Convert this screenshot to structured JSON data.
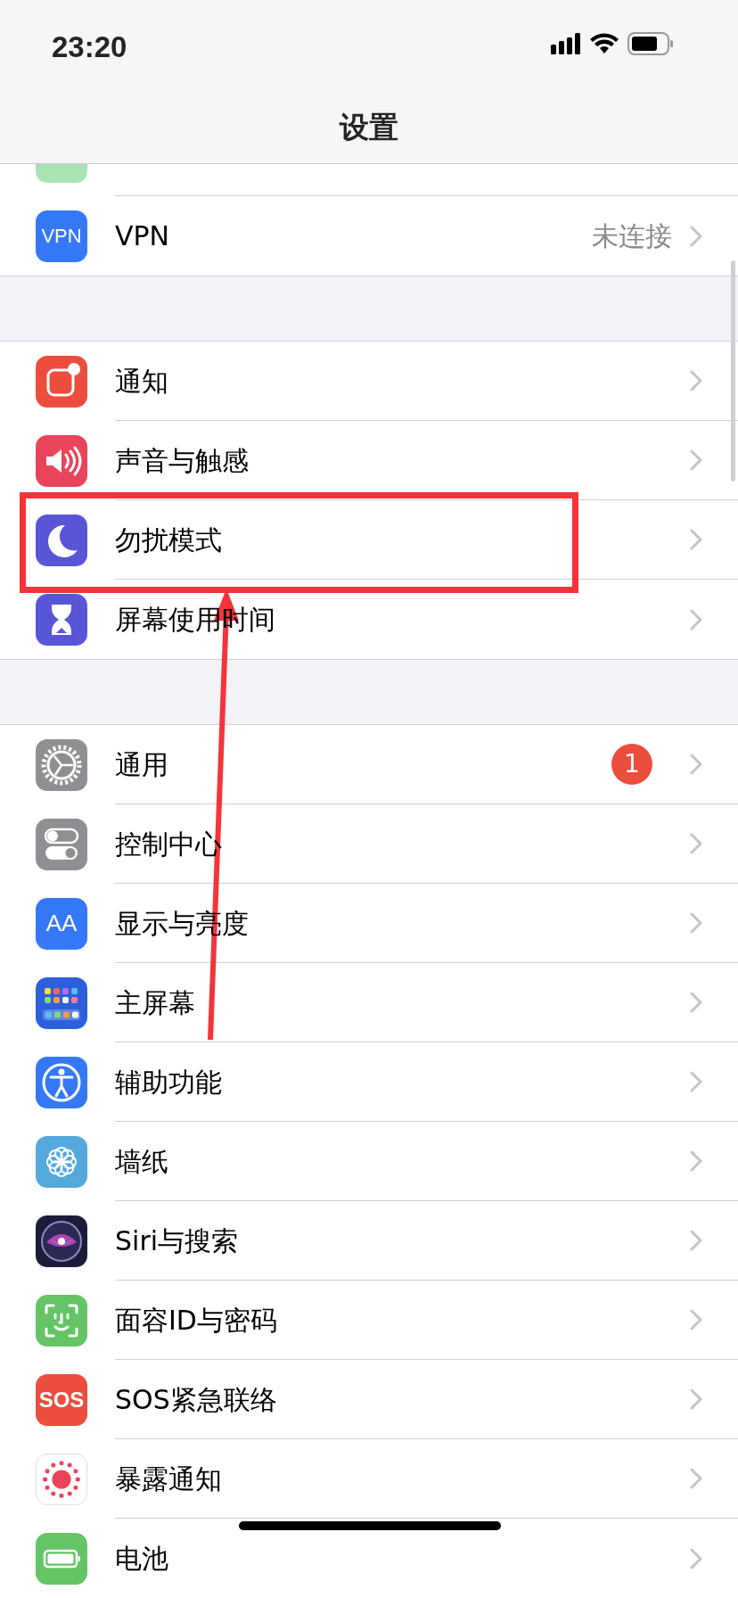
{
  "status_bar": {
    "time": "23:20"
  },
  "title": "设置",
  "sections": [
    {
      "rows": [
        {
          "kind": "cut"
        },
        {
          "kind": "row",
          "icon_text": "VPN",
          "label": "VPN",
          "value": "未连接"
        }
      ]
    },
    {
      "rows": [
        {
          "kind": "row",
          "label": "通知"
        },
        {
          "kind": "row",
          "label": "声音与触感"
        },
        {
          "kind": "row",
          "label": "勿扰模式",
          "highlighted": true
        },
        {
          "kind": "row",
          "label": "屏幕使用时间"
        }
      ]
    },
    {
      "rows": [
        {
          "kind": "row",
          "label": "通用",
          "badge": "1"
        },
        {
          "kind": "row",
          "label": "控制中心"
        },
        {
          "kind": "row",
          "icon_text": "AA",
          "label": "显示与亮度"
        },
        {
          "kind": "row",
          "label": "主屏幕"
        },
        {
          "kind": "row",
          "label": "辅助功能"
        },
        {
          "kind": "row",
          "label": "墙纸"
        },
        {
          "kind": "row",
          "label": "Siri与搜索"
        },
        {
          "kind": "row",
          "label": "面容ID与密码"
        },
        {
          "kind": "row",
          "icon_text": "SOS",
          "label": "SOS紧急联络"
        },
        {
          "kind": "row",
          "label": "暴露通知"
        },
        {
          "kind": "row",
          "label": "电池"
        }
      ]
    }
  ]
}
